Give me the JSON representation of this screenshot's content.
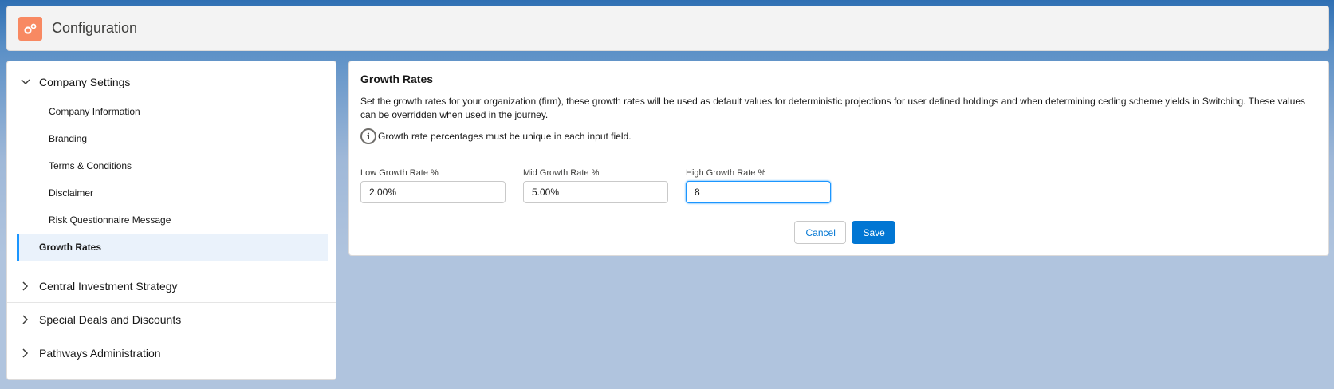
{
  "header": {
    "title": "Configuration",
    "icon": "gears-icon"
  },
  "sidebar": {
    "company_settings": {
      "label": "Company Settings",
      "items": [
        {
          "label": "Company Information"
        },
        {
          "label": "Branding"
        },
        {
          "label": "Terms & Conditions"
        },
        {
          "label": "Disclaimer"
        },
        {
          "label": "Risk Questionnaire Message"
        },
        {
          "label": "Growth Rates",
          "active": true
        }
      ]
    },
    "sections": [
      {
        "label": "Central Investment Strategy"
      },
      {
        "label": "Special Deals and Discounts"
      },
      {
        "label": "Pathways Administration"
      }
    ]
  },
  "panel": {
    "title": "Growth Rates",
    "description": "Set the growth rates for your organization (firm), these growth rates will be used as default values for deterministic projections for user defined holdings and when determining ceding scheme yields in Switching. These values can be overridden when used in the journey.",
    "info": "Growth rate percentages must be unique in each input field.",
    "fields": [
      {
        "label": "Low Growth Rate %",
        "value": "2.00%"
      },
      {
        "label": "Mid Growth Rate %",
        "value": "5.00%"
      },
      {
        "label": "High Growth Rate %",
        "value": "8"
      }
    ],
    "cancel_label": "Cancel",
    "save_label": "Save"
  },
  "colors": {
    "brand": "#0176d3",
    "app_icon": "#f88962",
    "active_bar": "#1b96ff"
  }
}
